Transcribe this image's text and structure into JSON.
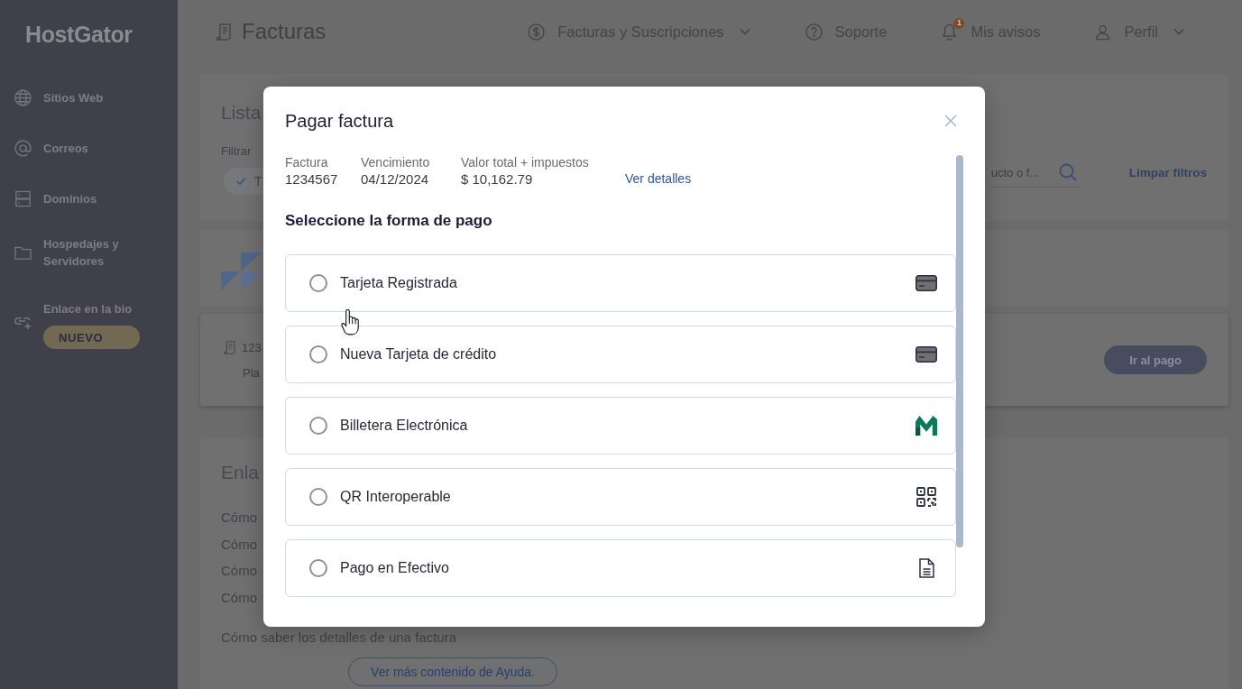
{
  "sidebar": {
    "logo": "HostGator",
    "items": [
      {
        "kind": "globe",
        "label": "Sitios Web"
      },
      {
        "kind": "email",
        "label": "Correos"
      },
      {
        "kind": "server",
        "label": "Dominios"
      },
      {
        "kind": "folder",
        "label": "Hospedajes y Servidores"
      },
      {
        "kind": "link",
        "label": "Enlace en la bio",
        "badge": "NUEVO"
      }
    ]
  },
  "header": {
    "title": "Facturas",
    "nav": [
      {
        "kind": "billing",
        "label": "Facturas y Suscripciones",
        "dropdown": true
      },
      {
        "kind": "help",
        "label": "Soporte",
        "dropdown": false
      },
      {
        "kind": "notifications",
        "label": "Mis avisos",
        "badge": "1",
        "dropdown": false
      },
      {
        "kind": "profile",
        "label": "Perfil",
        "dropdown": true
      }
    ]
  },
  "invoice_list": {
    "title": "Lista",
    "filter_label": "Filtrar",
    "filter_chip": {
      "label": "T",
      "checked": true
    },
    "search": {
      "placeholder": "ucto o f..."
    },
    "clear_link": "Limpar filtros"
  },
  "invoice_row": {
    "number": "123",
    "plan": "Pla",
    "pay_button": "Ir al pago"
  },
  "help": {
    "title": "Enla",
    "links": [
      "Cómo",
      "Cómo",
      "Cómo",
      "Cómo",
      "Cómo saber los detalles de una factura"
    ],
    "more_button": "Ver más contenido de Ayuda."
  },
  "modal": {
    "title": "Pagar factura",
    "details": [
      {
        "label": "Factura",
        "value": "1234567"
      },
      {
        "label": "Vencimiento",
        "value": "04/12/2024"
      },
      {
        "label": "Valor total + impuestos",
        "value": "$ 10,162.79"
      }
    ],
    "details_link": "Ver detalles",
    "section_title": "Seleccione la forma de pago",
    "options": [
      {
        "kind": "card",
        "label": "Tarjeta Registrada",
        "selected": false
      },
      {
        "kind": "card",
        "label": "Nueva Tarjeta de crédito",
        "selected": false
      },
      {
        "kind": "wallet",
        "label": "Billetera Electrónica",
        "selected": false
      },
      {
        "kind": "qr",
        "label": "QR Interoperable",
        "selected": false
      },
      {
        "kind": "cash",
        "label": "Pago en Efectivo",
        "selected": false
      }
    ]
  }
}
